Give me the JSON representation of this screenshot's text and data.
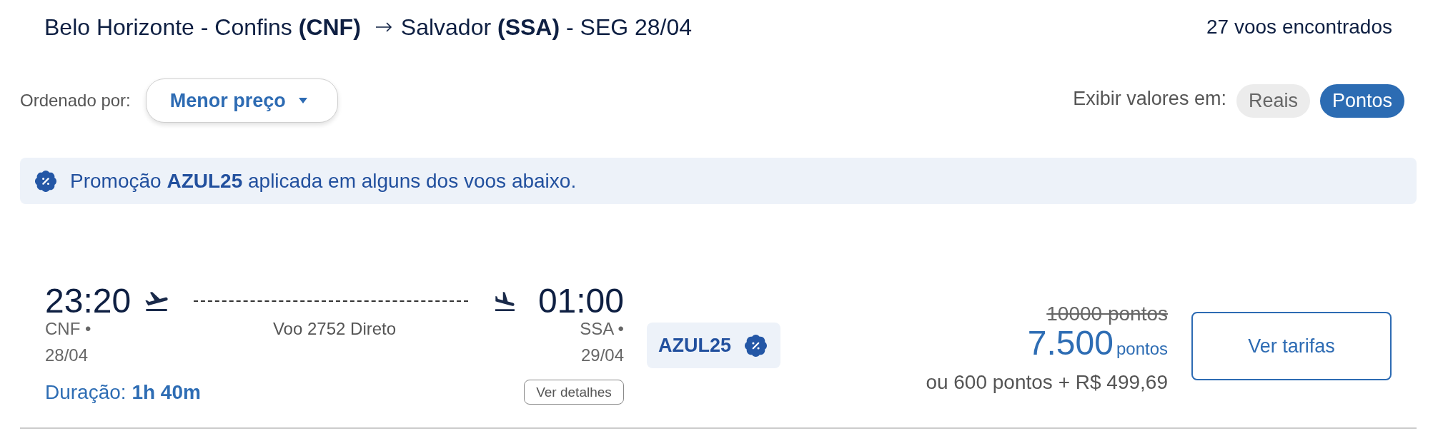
{
  "header": {
    "origin": "Belo Horizonte - Confins **(CNF)**",
    "destination": "Salvador **(SSA)** - SEG 28/04",
    "results_count": "27 voos encontrados"
  },
  "sort": {
    "label": "Ordenado por:",
    "value": "Menor preço"
  },
  "currency": {
    "label": "Exibir valores em:",
    "options": [
      {
        "label": "Reais",
        "selected": false
      },
      {
        "label": "Pontos",
        "selected": true
      }
    ]
  },
  "promo_banner": {
    "text": "Promoção **AZUL25** aplicada em alguns dos voos abaixo."
  },
  "flights": [
    {
      "departure": {
        "time": "23:20",
        "airport": "CNF •",
        "date": "28/04"
      },
      "flight_info": "Voo 2752 Direto",
      "arrival": {
        "time": "01:00",
        "airport": "SSA •",
        "date": "29/04"
      },
      "duration": "Duração: **1h 40m**",
      "details_button": "Ver detalhes",
      "promo_code": "AZUL25",
      "original_price": "10000 pontos",
      "price": "7.500",
      "price_unit": "pontos",
      "alternative_price": "ou 600 pontos + R$ 499,69",
      "fares_button": "Ver tarifas"
    }
  ]
}
